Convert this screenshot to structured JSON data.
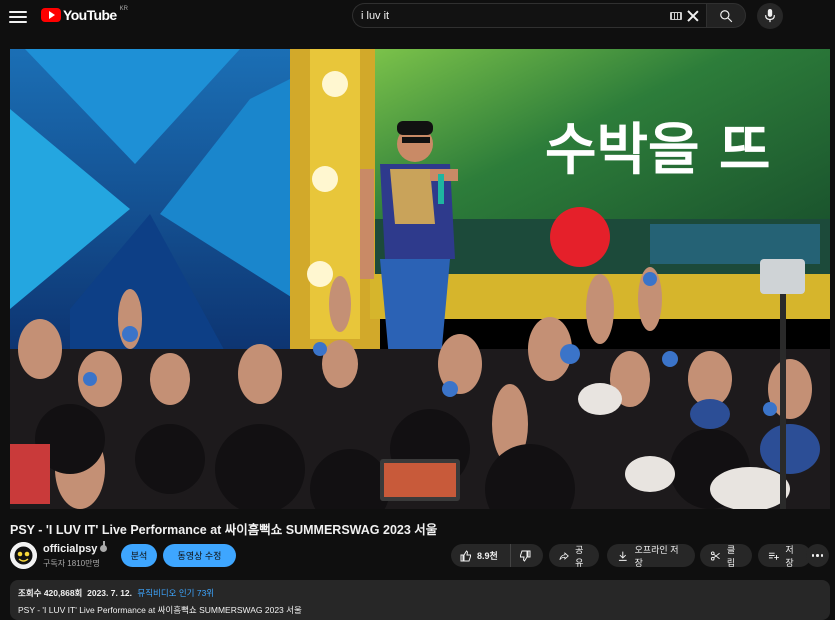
{
  "app": {
    "logo_text": "YouTube",
    "region": "KR"
  },
  "search": {
    "query": "i luv it",
    "placeholder": ""
  },
  "video": {
    "overlay_text": "수박을 뜨",
    "title": "PSY - 'I LUV IT' Live Performance at 싸이흠뻑쇼 SUMMERSWAG 2023 서울"
  },
  "channel": {
    "name": "officialpsy",
    "subscribers": "구독자 1810만명"
  },
  "actions": {
    "analytics": "분석",
    "edit_video": "동영상 수정",
    "like_count": "8.9천",
    "share": "공유",
    "offline_save": "오프라인 저장",
    "clip": "클립",
    "save": "저장"
  },
  "description": {
    "views": "조회수 420,868회",
    "date": "2023. 7. 12.",
    "tag": "뮤직비디오 인기 73위",
    "text": "PSY - 'I LUV IT' Live Performance at 싸이흠뻑쇼 SUMMERSWAG 2023 서울"
  },
  "colors": {
    "accent": "#3ea6ff",
    "brand": "#ff0000",
    "background": "#0f0f0f",
    "chip": "#272727"
  }
}
